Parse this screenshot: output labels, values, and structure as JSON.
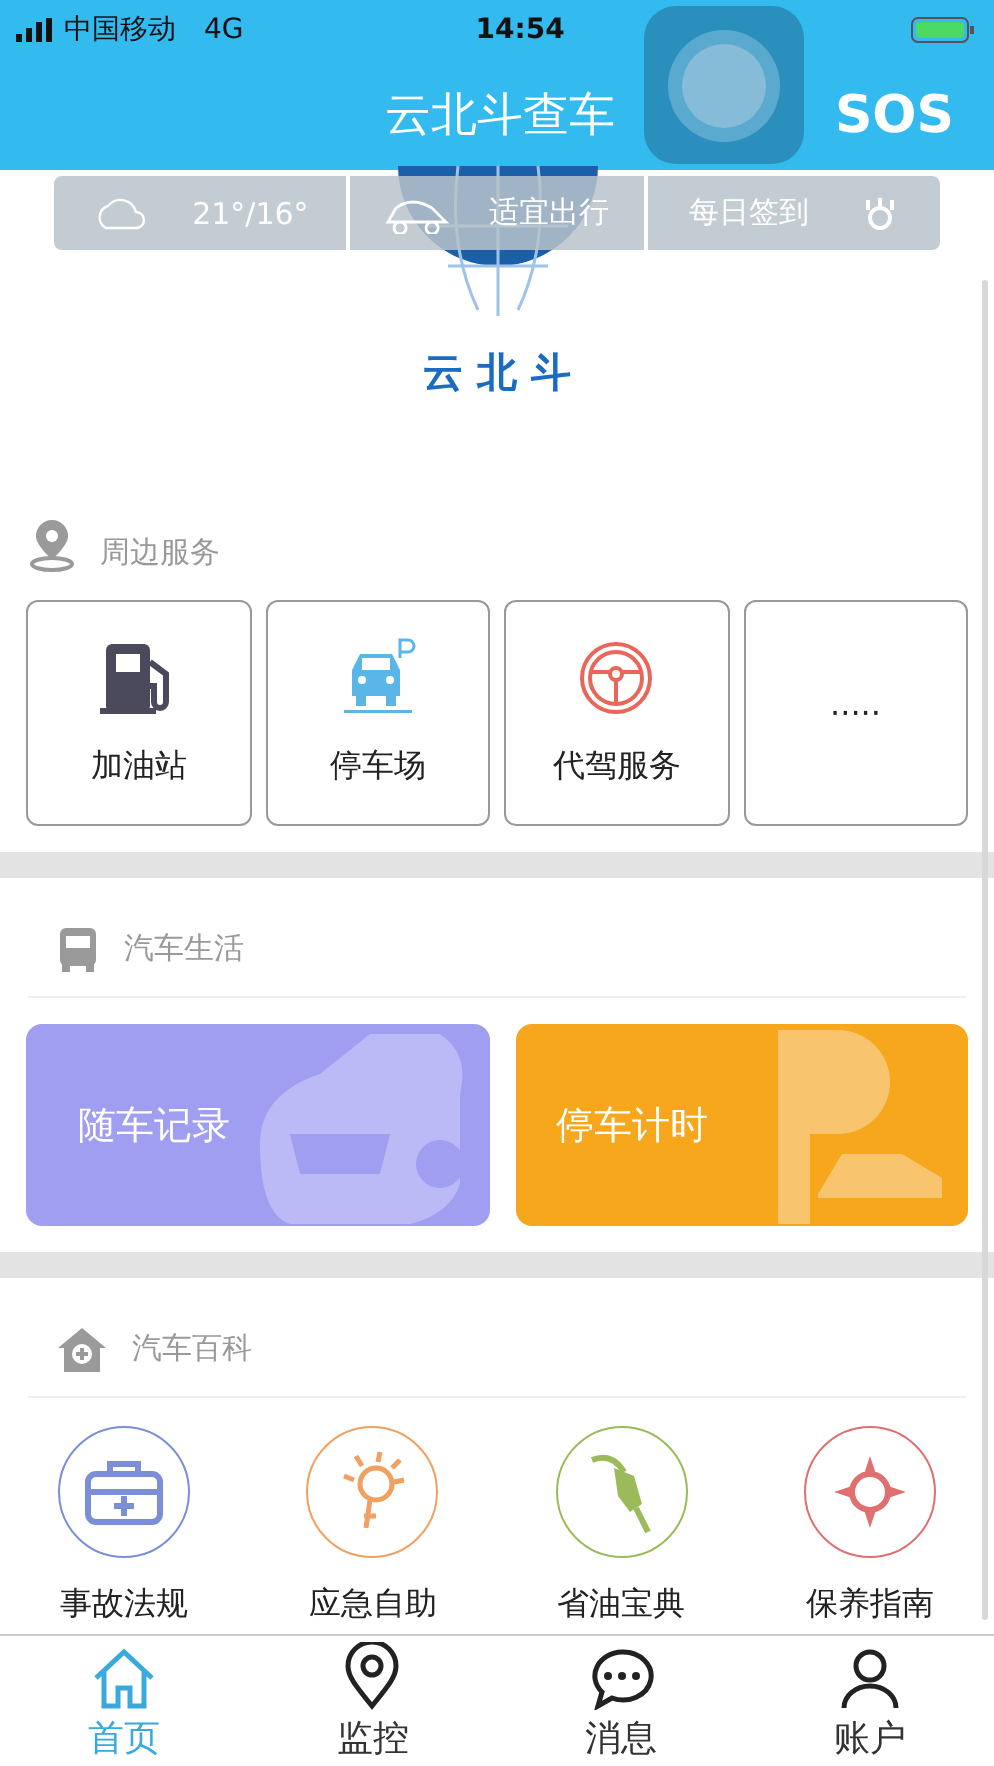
{
  "status_bar": {
    "carrier": "中国移动",
    "network": "4G",
    "time": "14:54"
  },
  "header": {
    "title": "云北斗查车",
    "sos": "SOS"
  },
  "weather_bar": {
    "temperature": "21°/16°",
    "travel": "适宜出行",
    "checkin": "每日签到"
  },
  "logo_text": "云 北 斗",
  "nearby": {
    "title": "周边服务",
    "items": [
      {
        "label": "加油站",
        "kind": "fuel"
      },
      {
        "label": "停车场",
        "kind": "parking"
      },
      {
        "label": "代驾服务",
        "kind": "driver"
      },
      {
        "label": "·····",
        "kind": "more"
      }
    ]
  },
  "life": {
    "title": "汽车生活",
    "cards": [
      {
        "label": "随车记录",
        "kind": "record"
      },
      {
        "label": "停车计时",
        "kind": "timer"
      }
    ]
  },
  "wiki": {
    "title": "汽车百科",
    "items": [
      {
        "label": "事故法规",
        "color": "#7b8fd6",
        "kind": "kit"
      },
      {
        "label": "应急自助",
        "color": "#f0a060",
        "kind": "bulb"
      },
      {
        "label": "省油宝典",
        "color": "#9bbb5a",
        "kind": "nozzle"
      },
      {
        "label": "保养指南",
        "color": "#e07070",
        "kind": "compass"
      }
    ]
  },
  "tabs": [
    {
      "label": "首页",
      "selected": true,
      "kind": "home"
    },
    {
      "label": "监控",
      "selected": false,
      "kind": "pin"
    },
    {
      "label": "消息",
      "selected": false,
      "kind": "chat"
    },
    {
      "label": "账户",
      "selected": false,
      "kind": "user"
    }
  ]
}
